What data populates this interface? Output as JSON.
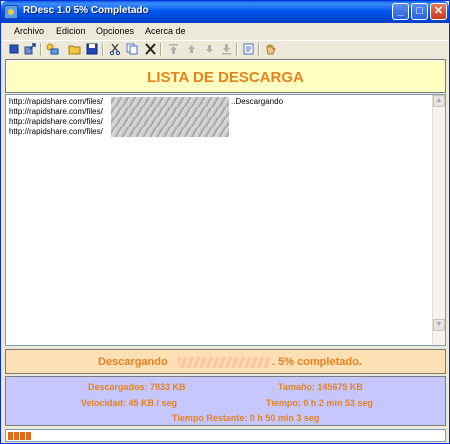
{
  "window": {
    "title": "RDesc 1.0  5% Completado",
    "min_glyph": "_",
    "max_glyph": "□",
    "close_glyph": "✕"
  },
  "menu": [
    "Archivo",
    "Edicion",
    "Opciones",
    "Acerca de"
  ],
  "toolbar": {
    "icons": [
      "stop-icon",
      "export-icon",
      "add-link-icon",
      "open-folder-icon",
      "save-icon",
      "cut-icon",
      "copy-icon",
      "delete-icon",
      "move-top-icon",
      "move-up-icon",
      "move-down-icon",
      "move-bottom-icon",
      "properties-icon",
      "hand-icon"
    ]
  },
  "header": {
    "title": "LISTA DE DESCARGA"
  },
  "downloads": [
    {
      "url": "http://rapidshare.com/files/",
      "status": "..Descargando"
    },
    {
      "url": "http://rapidshare.com/files/",
      "status": ""
    },
    {
      "url": "http://rapidshare.com/files/",
      "status": ""
    },
    {
      "url": "http://rapidshare.com/files/",
      "status": ""
    }
  ],
  "status": {
    "prefix": "Descargando",
    "suffix": ".  5% completado."
  },
  "stats": {
    "descargados": "Descargados:  7933 KB",
    "tamano": "Tamaño:  145675 KB",
    "velocidad": "Velocidad:  45 KB / seg",
    "tiempo": "Tiempo: 0 h 2 min 53 seg",
    "restante": "Tiempo Restante:  0 h 50 min 3 seg"
  },
  "progress": {
    "percent": 5
  },
  "colors": {
    "accent_orange": "#e7821f",
    "header_bg": "#ffffc1",
    "status_bg": "#ffdfb4",
    "stats_bg": "#c6c7ff",
    "titlebar": "#0058ee"
  }
}
